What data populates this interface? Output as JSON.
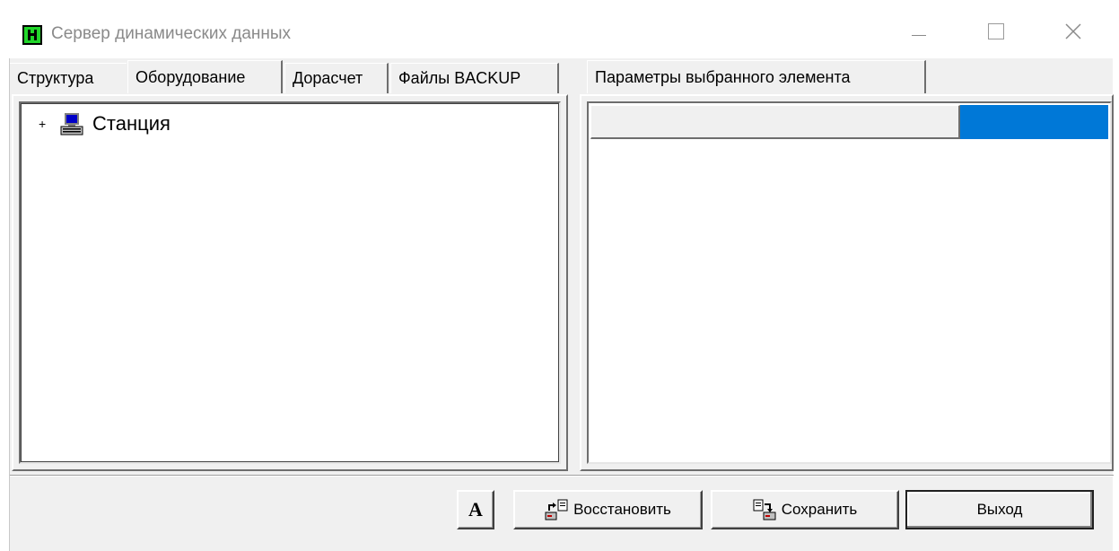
{
  "window": {
    "title": "Сервер динамических данных"
  },
  "left_tabs": [
    {
      "label": "Структура"
    },
    {
      "label": "Оборудование"
    },
    {
      "label": "Дорасчет"
    },
    {
      "label": "Файлы BACKUP"
    }
  ],
  "left_tabs_active": "Оборудование",
  "tree": {
    "root": {
      "expander": "+",
      "label": "Станция",
      "icon": "computer-icon"
    }
  },
  "right_tabs": [
    {
      "label": "Параметры выбранного элемента"
    }
  ],
  "buttons": {
    "font": "A",
    "restore": "Восстановить",
    "save": "Сохранить",
    "exit": "Выход"
  },
  "colors": {
    "selection": "#0078d7",
    "app_icon": "#21d62a",
    "face": "#f0f0f0"
  }
}
